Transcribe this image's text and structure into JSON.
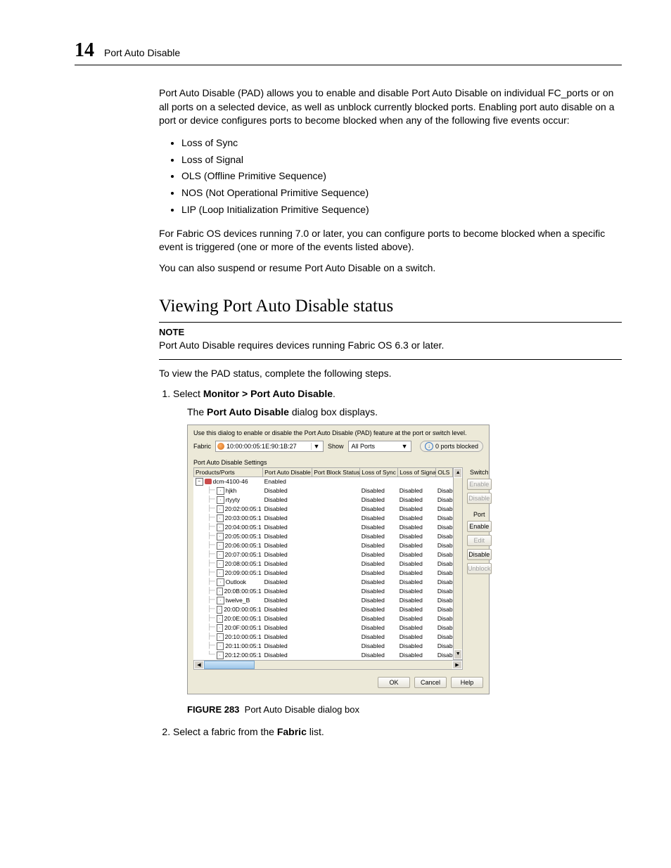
{
  "header": {
    "chapter_number": "14",
    "chapter_title": "Port Auto Disable"
  },
  "intro": {
    "p1": "Port Auto Disable (PAD) allows you to enable and disable Port Auto Disable on individual FC_ports or on all ports on a selected device, as well as unblock currently blocked ports. Enabling port auto disable on a port or device configures ports to become blocked when any of the following five events occur:",
    "bullets": [
      "Loss of Sync",
      "Loss of Signal",
      "OLS (Offline Primitive Sequence)",
      "NOS (Not Operational Primitive Sequence)",
      "LIP (Loop Initialization Primitive Sequence)"
    ],
    "p2": "For Fabric OS devices running 7.0 or later, you can configure ports to become blocked when a specific event is triggered (one or more of the events listed above).",
    "p3": "You can also suspend or resume Port Auto Disable on a switch."
  },
  "section": {
    "title": "Viewing Port Auto Disable status",
    "note_label": "NOTE",
    "note_text": "Port Auto Disable requires devices running Fabric OS 6.3 or later.",
    "lead": "To view the PAD status, complete the following steps.",
    "step1_pre": "Select ",
    "step1_bold": "Monitor > Port Auto Disable",
    "step1_post": ".",
    "step1_sub_pre": "The ",
    "step1_sub_bold": "Port Auto Disable",
    "step1_sub_post": " dialog box displays.",
    "step2_pre": "Select a fabric from the ",
    "step2_bold": "Fabric",
    "step2_post": " list."
  },
  "dialog": {
    "intro": "Use this dialog to enable or disable the Port Auto Disable (PAD) feature at the port or switch level.",
    "fabric_label": "Fabric",
    "fabric_value": "10:00:00:05:1E:90:1B:27",
    "show_label": "Show",
    "show_value": "All Ports",
    "blocked_text": "0 ports blocked",
    "settings_label": "Port Auto Disable Settings",
    "columns": [
      "Products/Ports",
      "Port Auto Disable",
      "Port Block Status",
      "Loss of Sync",
      "Loss of Signal",
      "OLS"
    ],
    "side": {
      "switch_title": "Switch",
      "switch_enable": "Enable",
      "switch_disable": "Disable",
      "port_title": "Port",
      "port_enable": "Enable",
      "port_edit": "Edit",
      "port_disable": "Disable",
      "port_unblock": "Unblock"
    },
    "buttons": {
      "ok": "OK",
      "cancel": "Cancel",
      "help": "Help"
    },
    "root": {
      "name": "dcm-4100-46",
      "pad": "Enabled"
    },
    "rows": [
      {
        "name": "hjkh",
        "pad": "Disabled",
        "sync": "Disabled",
        "sig": "Disabled",
        "ols": "Disab"
      },
      {
        "name": "rtyyty",
        "pad": "Disabled",
        "sync": "Disabled",
        "sig": "Disabled",
        "ols": "Disab"
      },
      {
        "name": "20:02:00:05:1",
        "pad": "Disabled",
        "sync": "Disabled",
        "sig": "Disabled",
        "ols": "Disab"
      },
      {
        "name": "20:03:00:05:1",
        "pad": "Disabled",
        "sync": "Disabled",
        "sig": "Disabled",
        "ols": "Disab"
      },
      {
        "name": "20:04:00:05:1",
        "pad": "Disabled",
        "sync": "Disabled",
        "sig": "Disabled",
        "ols": "Disab"
      },
      {
        "name": "20:05:00:05:1",
        "pad": "Disabled",
        "sync": "Disabled",
        "sig": "Disabled",
        "ols": "Disab"
      },
      {
        "name": "20:06:00:05:1",
        "pad": "Disabled",
        "sync": "Disabled",
        "sig": "Disabled",
        "ols": "Disab"
      },
      {
        "name": "20:07:00:05:1",
        "pad": "Disabled",
        "sync": "Disabled",
        "sig": "Disabled",
        "ols": "Disab"
      },
      {
        "name": "20:08:00:05:1",
        "pad": "Disabled",
        "sync": "Disabled",
        "sig": "Disabled",
        "ols": "Disab"
      },
      {
        "name": "20:09:00:05:1",
        "pad": "Disabled",
        "sync": "Disabled",
        "sig": "Disabled",
        "ols": "Disab"
      },
      {
        "name": "Outlook",
        "pad": "Disabled",
        "sync": "Disabled",
        "sig": "Disabled",
        "ols": "Disab"
      },
      {
        "name": "20:0B:00:05:1",
        "pad": "Disabled",
        "sync": "Disabled",
        "sig": "Disabled",
        "ols": "Disab"
      },
      {
        "name": "twelve_B",
        "pad": "Disabled",
        "sync": "Disabled",
        "sig": "Disabled",
        "ols": "Disab"
      },
      {
        "name": "20:0D:00:05:1",
        "pad": "Disabled",
        "sync": "Disabled",
        "sig": "Disabled",
        "ols": "Disab"
      },
      {
        "name": "20:0E:00:05:1",
        "pad": "Disabled",
        "sync": "Disabled",
        "sig": "Disabled",
        "ols": "Disab"
      },
      {
        "name": "20:0F:00:05:1",
        "pad": "Disabled",
        "sync": "Disabled",
        "sig": "Disabled",
        "ols": "Disab"
      },
      {
        "name": "20:10:00:05:1",
        "pad": "Disabled",
        "sync": "Disabled",
        "sig": "Disabled",
        "ols": "Disab"
      },
      {
        "name": "20:11:00:05:1",
        "pad": "Disabled",
        "sync": "Disabled",
        "sig": "Disabled",
        "ols": "Disab"
      },
      {
        "name": "20:12:00:05:1",
        "pad": "Disabled",
        "sync": "Disabled",
        "sig": "Disabled",
        "ols": "Disab"
      }
    ]
  },
  "figure": {
    "label": "FIGURE 283",
    "caption": "Port Auto Disable dialog box"
  }
}
